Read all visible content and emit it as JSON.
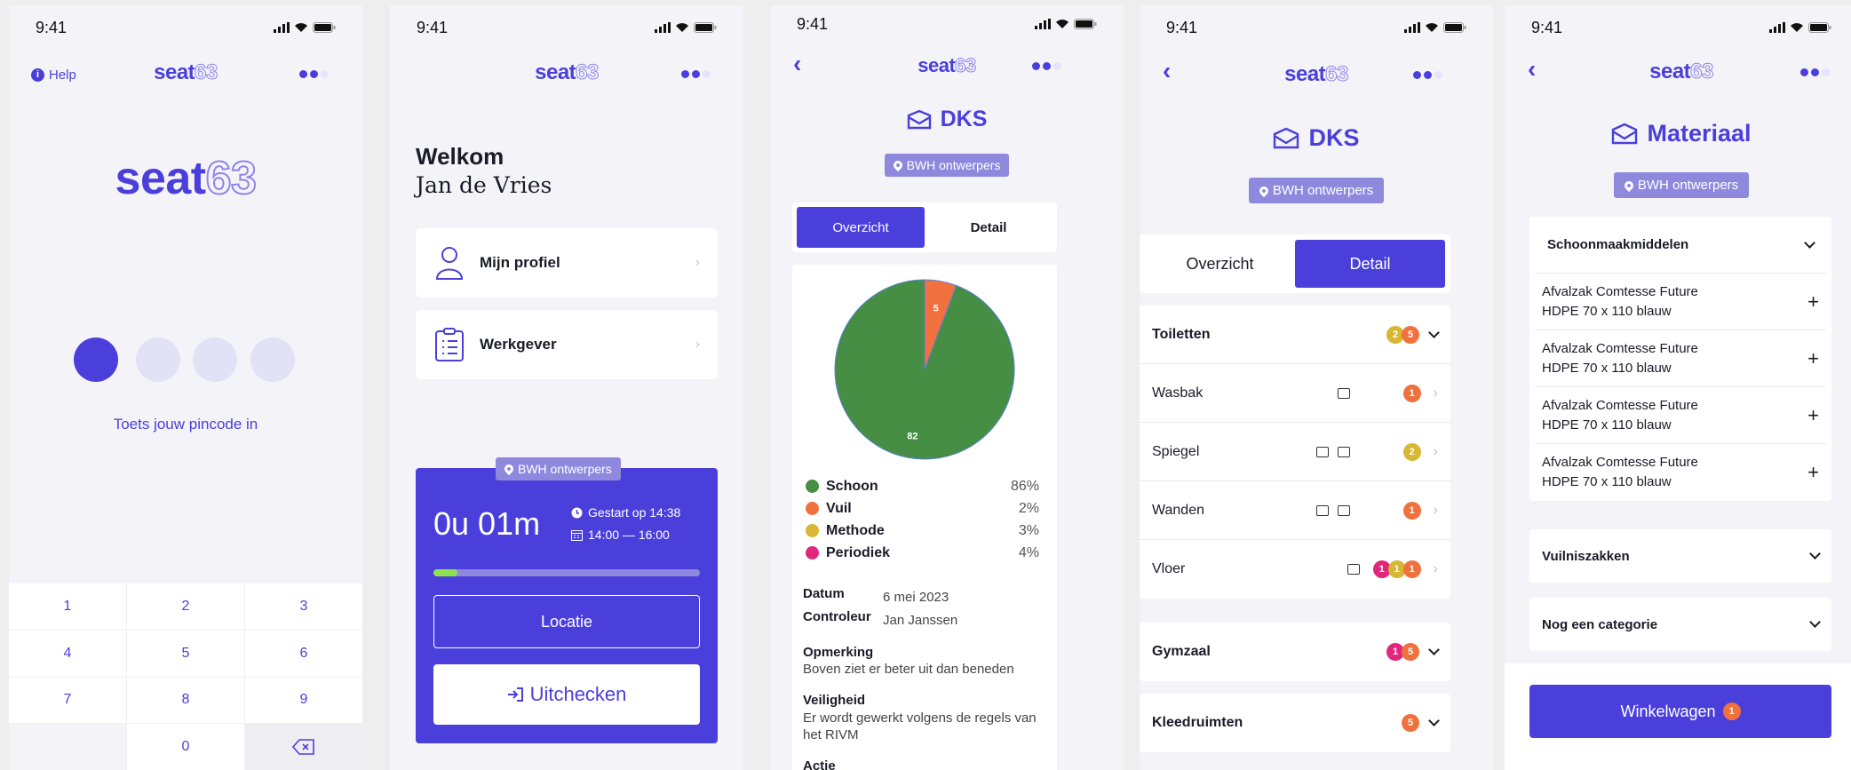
{
  "status": {
    "time": "9:41"
  },
  "brand": {
    "word": "seat",
    "num": "63"
  },
  "colors": {
    "accent": "#4b3fdc",
    "accent_light": "#8f89de",
    "schoon": "#458e43",
    "vuil": "#f0713e",
    "methode": "#d7b734",
    "periodiek": "#e0267d"
  },
  "login": {
    "help": "Help",
    "prompt": "Toets jouw pincode in",
    "keys": [
      "1",
      "2",
      "3",
      "4",
      "5",
      "6",
      "7",
      "8",
      "9",
      "",
      "0",
      ""
    ]
  },
  "home": {
    "welcome": "Welkom",
    "user": "Jan de Vries",
    "menu": [
      {
        "label": "Mijn profiel",
        "icon": "profile-icon"
      },
      {
        "label": "Werkgever",
        "icon": "clipboard-list-icon"
      }
    ],
    "location": "BWH ontwerpers",
    "timer": "0u 01m",
    "started": "Gestart op 14:38",
    "window": "14:00 — 16:00",
    "progress": 0.09,
    "btn_location": "Locatie",
    "btn_checkout": "Uitchecken"
  },
  "overview": {
    "title": "DKS",
    "location": "BWH ontwerpers",
    "tabs": [
      "Overzicht",
      "Detail"
    ],
    "legend": [
      {
        "label": "Schoon",
        "pct": "86%"
      },
      {
        "label": "Vuil",
        "pct": "2%"
      },
      {
        "label": "Methode",
        "pct": "3%"
      },
      {
        "label": "Periodiek",
        "pct": "4%"
      }
    ],
    "datum_label": "Datum",
    "datum": "6 mei 2023",
    "controleur_label": "Controleur",
    "controleur": "Jan Janssen",
    "opmerking_label": "Opmerking",
    "opmerking": "Boven ziet er beter uit dan beneden",
    "veiligheid_label": "Veiligheid",
    "veiligheid": "Er wordt gewerkt volgens de regels van het RIVM",
    "actie_label": "Actie"
  },
  "chart_data": {
    "type": "pie",
    "categories": [
      "Schoon",
      "Vuil"
    ],
    "values": [
      82,
      5
    ],
    "data_labels": [
      "82",
      "5"
    ]
  },
  "detail": {
    "title": "DKS",
    "location": "BWH ontwerpers",
    "tabs": [
      "Overzicht",
      "Detail"
    ],
    "group_toiletten": "Toiletten",
    "toiletten_badges": [
      "2",
      "5"
    ],
    "items": [
      {
        "name": "Wasbak",
        "badges": [
          "1"
        ]
      },
      {
        "name": "Spiegel",
        "badges": [
          "2"
        ]
      },
      {
        "name": "Wanden",
        "badges": [
          "1"
        ]
      },
      {
        "name": "Vloer",
        "badges": [
          "1",
          "1",
          "1"
        ]
      }
    ],
    "group_gymzaal": "Gymzaal",
    "gymzaal_badges": [
      "1",
      "5"
    ],
    "group_kleedruimten": "Kleedruimten",
    "kleedruimten_badges": [
      "5"
    ]
  },
  "material": {
    "title": "Materiaal",
    "location": "BWH ontwerpers",
    "category1": "Schoonmaakmiddelen",
    "products": [
      {
        "l1": "Afvalzak Comtesse Future",
        "l2": "HDPE 70 x 110 blauw"
      },
      {
        "l1": "Afvalzak Comtesse Future",
        "l2": "HDPE 70 x 110 blauw"
      },
      {
        "l1": "Afvalzak Comtesse Future",
        "l2": "HDPE 70 x 110 blauw"
      },
      {
        "l1": "Afvalzak Comtesse Future",
        "l2": "HDPE 70 x 110 blauw"
      }
    ],
    "category2": "Vuilniszakken",
    "category3": "Nog een categorie",
    "cart_label": "Winkelwagen",
    "cart_count": "1"
  }
}
